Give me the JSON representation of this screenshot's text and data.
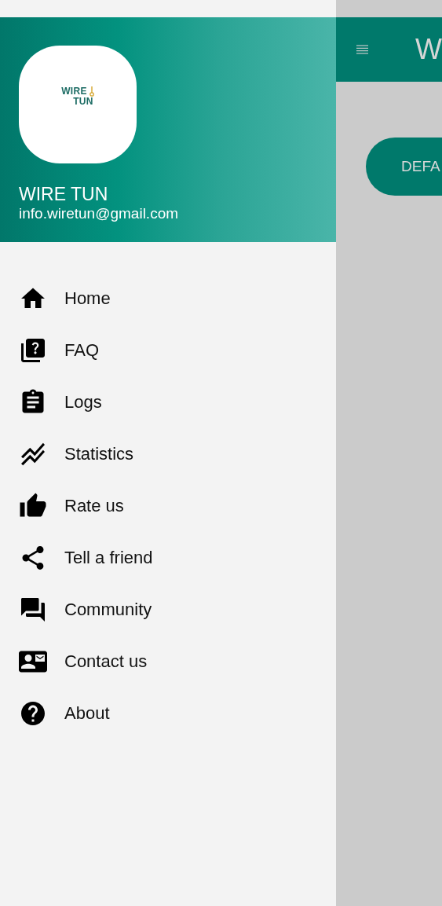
{
  "drawer": {
    "logo": {
      "line_1": "WIRE",
      "line_2": "TUN"
    },
    "user": {
      "name": "WIRE TUN",
      "email": "info.wiretun@gmail.com"
    },
    "items": [
      {
        "label": "Home"
      },
      {
        "label": "FAQ"
      },
      {
        "label": "Logs"
      },
      {
        "label": "Statistics"
      },
      {
        "label": "Rate us"
      },
      {
        "label": "Tell a friend"
      },
      {
        "label": "Community"
      },
      {
        "label": "Contact us"
      },
      {
        "label": "About"
      }
    ]
  },
  "app_bar": {
    "title": "W"
  },
  "button": {
    "label": "DEFA"
  }
}
